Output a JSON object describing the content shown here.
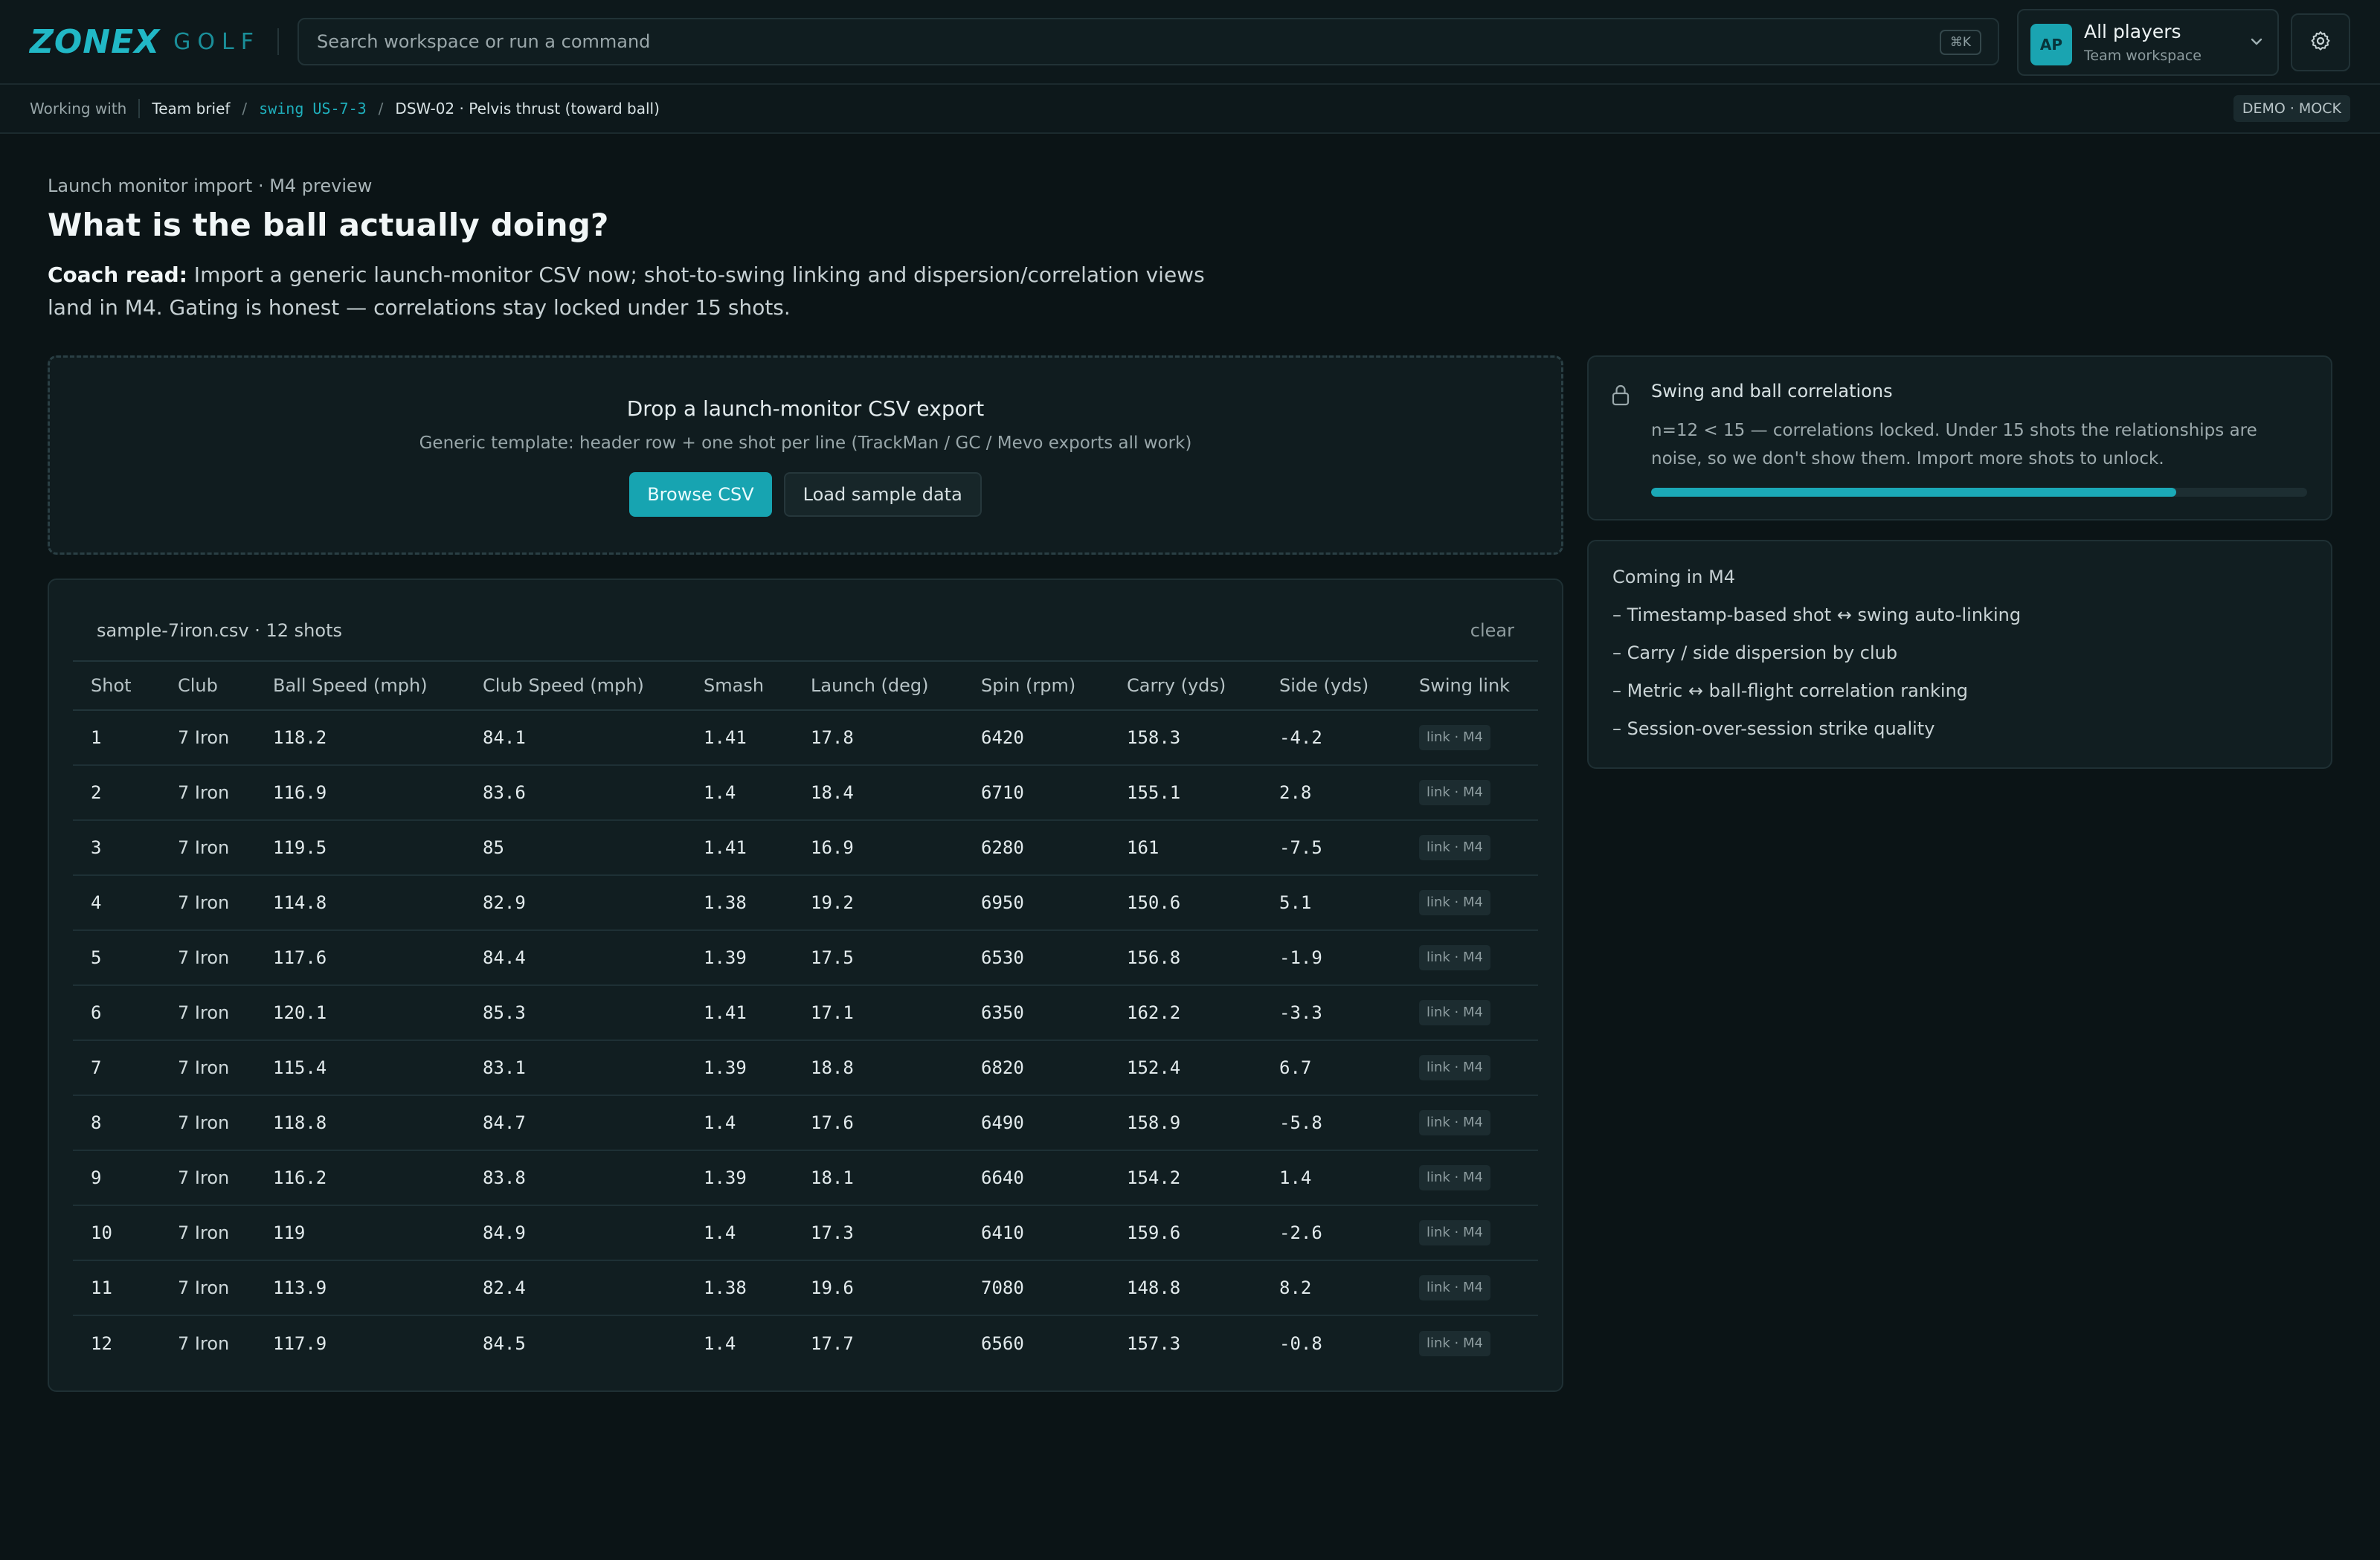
{
  "topbar": {
    "brand": "ZONEX",
    "brand_sub": "GOLF",
    "search_placeholder": "Search workspace or run a command",
    "search_shortcut": "⌘K",
    "workspace": {
      "avatar_initials": "AP",
      "title": "All players",
      "subtitle": "Team workspace"
    }
  },
  "breadcrumb": {
    "working_with": "Working with",
    "items": [
      "Team brief",
      "swing US-7-3",
      "DSW-02 · Pelvis thrust (toward ball)"
    ],
    "badge": "DEMO · MOCK"
  },
  "header": {
    "eyebrow": "Launch monitor import · M4 preview",
    "title": "What is the ball actually doing?",
    "coach_label": "Coach read:",
    "coach_text": " Import a generic launch-monitor CSV now; shot-to-swing linking and dispersion/correlation views land in M4. Gating is honest — correlations stay locked under 15 shots."
  },
  "dropzone": {
    "title": "Drop a launch-monitor CSV export",
    "subtitle": "Generic template: header row + one shot per line (TrackMan / GC / Mevo exports all work)",
    "browse_label": "Browse CSV",
    "sample_label": "Load sample data"
  },
  "table": {
    "file_info": "sample-7iron.csv · 12 shots",
    "clear_label": "clear",
    "columns": [
      "Shot",
      "Club",
      "Ball Speed (mph)",
      "Club Speed (mph)",
      "Smash",
      "Launch (deg)",
      "Spin (rpm)",
      "Carry (yds)",
      "Side (yds)",
      "Swing link"
    ],
    "rows": [
      [
        "1",
        "7 Iron",
        "118.2",
        "84.1",
        "1.41",
        "17.8",
        "6420",
        "158.3",
        "-4.2",
        "link · M4"
      ],
      [
        "2",
        "7 Iron",
        "116.9",
        "83.6",
        "1.4",
        "18.4",
        "6710",
        "155.1",
        "2.8",
        "link · M4"
      ],
      [
        "3",
        "7 Iron",
        "119.5",
        "85",
        "1.41",
        "16.9",
        "6280",
        "161",
        "-7.5",
        "link · M4"
      ],
      [
        "4",
        "7 Iron",
        "114.8",
        "82.9",
        "1.38",
        "19.2",
        "6950",
        "150.6",
        "5.1",
        "link · M4"
      ],
      [
        "5",
        "7 Iron",
        "117.6",
        "84.4",
        "1.39",
        "17.5",
        "6530",
        "156.8",
        "-1.9",
        "link · M4"
      ],
      [
        "6",
        "7 Iron",
        "120.1",
        "85.3",
        "1.41",
        "17.1",
        "6350",
        "162.2",
        "-3.3",
        "link · M4"
      ],
      [
        "7",
        "7 Iron",
        "115.4",
        "83.1",
        "1.39",
        "18.8",
        "6820",
        "152.4",
        "6.7",
        "link · M4"
      ],
      [
        "8",
        "7 Iron",
        "118.8",
        "84.7",
        "1.4",
        "17.6",
        "6490",
        "158.9",
        "-5.8",
        "link · M4"
      ],
      [
        "9",
        "7 Iron",
        "116.2",
        "83.8",
        "1.39",
        "18.1",
        "6640",
        "154.2",
        "1.4",
        "link · M4"
      ],
      [
        "10",
        "7 Iron",
        "119",
        "84.9",
        "1.4",
        "17.3",
        "6410",
        "159.6",
        "-2.6",
        "link · M4"
      ],
      [
        "11",
        "7 Iron",
        "113.9",
        "82.4",
        "1.38",
        "19.6",
        "7080",
        "148.8",
        "8.2",
        "link · M4"
      ],
      [
        "12",
        "7 Iron",
        "117.9",
        "84.5",
        "1.4",
        "17.7",
        "6560",
        "157.3",
        "-0.8",
        "link · M4"
      ]
    ]
  },
  "correlations": {
    "title": "Swing and ball correlations",
    "text": "n=12  <  15 — correlations locked. Under 15 shots the relationships are noise, so we don't show them. Import more shots to unlock.",
    "progress_fraction": 0.8,
    "icon": "lock-icon"
  },
  "coming": {
    "title": "Coming in M4",
    "items": [
      "– Timestamp-based shot ↔ swing auto-linking",
      "– Carry / side dispersion by club",
      "– Metric ↔ ball-flight correlation ranking",
      "– Session-over-session strike quality"
    ]
  },
  "colors": {
    "accent": "#1ba9b7",
    "background": "#0b1416",
    "card": "#111e21"
  }
}
